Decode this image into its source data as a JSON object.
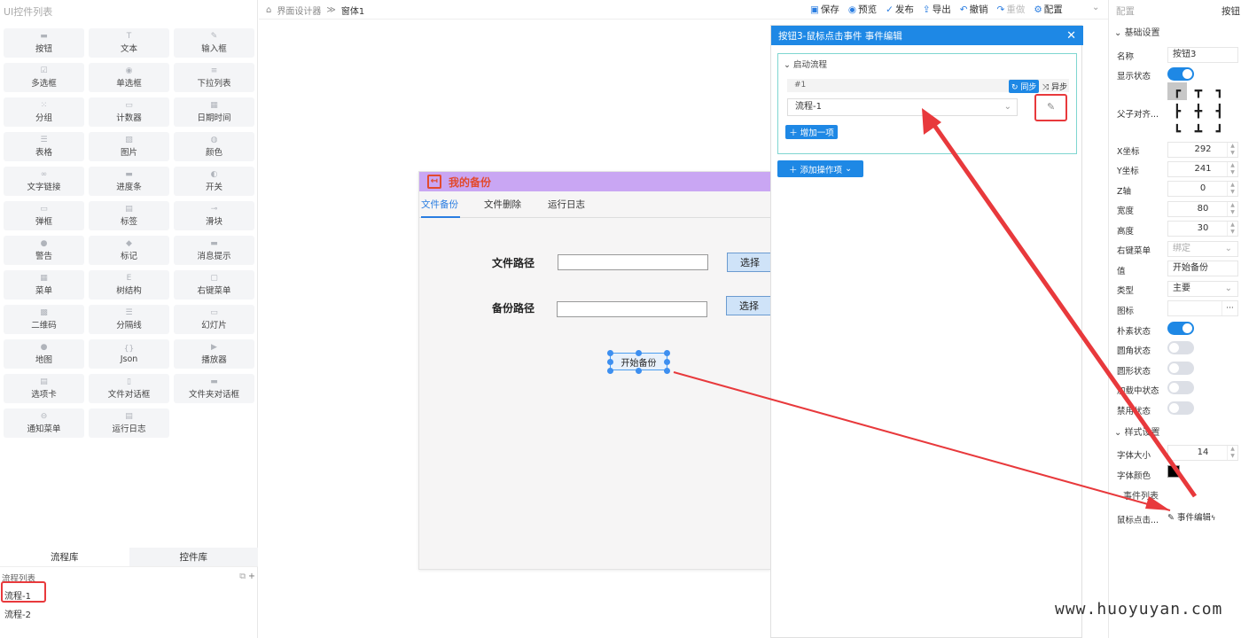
{
  "left_panel": {
    "title": "UI控件列表",
    "widgets": [
      {
        "label": "按钮",
        "icon": "▬"
      },
      {
        "label": "文本",
        "icon": "T"
      },
      {
        "label": "输入框",
        "icon": "✎"
      },
      {
        "label": "多选框",
        "icon": "☑"
      },
      {
        "label": "单选框",
        "icon": "◉"
      },
      {
        "label": "下拉列表",
        "icon": "≡"
      },
      {
        "label": "分组",
        "icon": "⁙"
      },
      {
        "label": "计数器",
        "icon": "▭"
      },
      {
        "label": "日期时间",
        "icon": "▦"
      },
      {
        "label": "表格",
        "icon": "☰"
      },
      {
        "label": "图片",
        "icon": "▨"
      },
      {
        "label": "颜色",
        "icon": "◍"
      },
      {
        "label": "文字链接",
        "icon": "∞"
      },
      {
        "label": "进度条",
        "icon": "▬"
      },
      {
        "label": "开关",
        "icon": "◐"
      },
      {
        "label": "弹框",
        "icon": "▭"
      },
      {
        "label": "标签",
        "icon": "▤"
      },
      {
        "label": "滑块",
        "icon": "⊸"
      },
      {
        "label": "警告",
        "icon": "●"
      },
      {
        "label": "标记",
        "icon": "◆"
      },
      {
        "label": "消息提示",
        "icon": "▬"
      },
      {
        "label": "菜单",
        "icon": "▦"
      },
      {
        "label": "树结构",
        "icon": "E"
      },
      {
        "label": "右键菜单",
        "icon": "▢"
      },
      {
        "label": "二维码",
        "icon": "▩"
      },
      {
        "label": "分隔线",
        "icon": "☰"
      },
      {
        "label": "幻灯片",
        "icon": "▭"
      },
      {
        "label": "地图",
        "icon": "●"
      },
      {
        "label": "Json",
        "icon": "{}"
      },
      {
        "label": "播放器",
        "icon": "▶"
      },
      {
        "label": "选项卡",
        "icon": "▤"
      },
      {
        "label": "文件对话框",
        "icon": "▯"
      },
      {
        "label": "文件夹对话框",
        "icon": "▬"
      },
      {
        "label": "通知菜单",
        "icon": "⊖"
      },
      {
        "label": "运行日志",
        "icon": "▤"
      }
    ],
    "tabs": [
      "流程库",
      "控件库"
    ],
    "flow_list_title": "流程列表",
    "flows": [
      "流程-1",
      "流程-2"
    ]
  },
  "topbar": {
    "breadcrumb_home": "界面设计器",
    "breadcrumb_sep": "≫",
    "breadcrumb_current": "窗体1",
    "actions": [
      {
        "label": "保存",
        "icon": "▣",
        "disabled": false
      },
      {
        "label": "预览",
        "icon": "◉",
        "disabled": false
      },
      {
        "label": "发布",
        "icon": "✓",
        "disabled": false
      },
      {
        "label": "导出",
        "icon": "⇪",
        "disabled": false
      },
      {
        "label": "撤销",
        "icon": "↶",
        "disabled": false
      },
      {
        "label": "重做",
        "icon": "↷",
        "disabled": true
      },
      {
        "label": "配置",
        "icon": "⚙",
        "disabled": false
      }
    ]
  },
  "form": {
    "title": "我的备份",
    "tabs": [
      "文件备份",
      "文件删除",
      "运行日志"
    ],
    "active_tab": 0,
    "file_path_label": "文件路径",
    "backup_path_label": "备份路径",
    "choose_label": "选择",
    "start_button": "开始备份"
  },
  "dialog": {
    "title": "按钮3-鼠标点击事件 事件编辑",
    "close": "✕",
    "section": "启动流程",
    "step_no": "#1",
    "sync": "同步",
    "async": "异步",
    "selected_flow": "流程-1",
    "add_item": "增加一项",
    "add_action": "添加操作项"
  },
  "right_panel": {
    "title": "配置",
    "subject": "按钮",
    "basic_section": "基础设置",
    "name_label": "名称",
    "name_value": "按钮3",
    "visible_label": "显示状态",
    "align_label": "父子对齐...",
    "x_label": "X坐标",
    "x_value": "292",
    "y_label": "Y坐标",
    "y_value": "241",
    "z_label": "Z轴",
    "z_value": "0",
    "width_label": "宽度",
    "width_value": "80",
    "height_label": "高度",
    "height_value": "30",
    "context_menu_label": "右键菜单",
    "context_menu_value": "绑定",
    "value_label": "值",
    "value_value": "开始备份",
    "type_label": "类型",
    "type_value": "主要",
    "icon_label": "图标",
    "icon_btn": "···",
    "plain_label": "朴素状态",
    "round_label": "圆角状态",
    "circle_label": "圆形状态",
    "loading_label": "加载中状态",
    "disabled_label": "禁用状态",
    "style_section": "样式设置",
    "font_size_label": "字体大小",
    "font_size_value": "14",
    "font_color_label": "字体颜色",
    "font_color_value": "#000000",
    "events_section": "事件列表",
    "click_event_label": "鼠标点击...",
    "click_event_btn": "事件编辑"
  },
  "watermark": "www.huoyuyan.com",
  "colors": {
    "accent": "#1e88e5",
    "annotation_red": "#e8393c",
    "form_header": "#c9a6f3"
  }
}
